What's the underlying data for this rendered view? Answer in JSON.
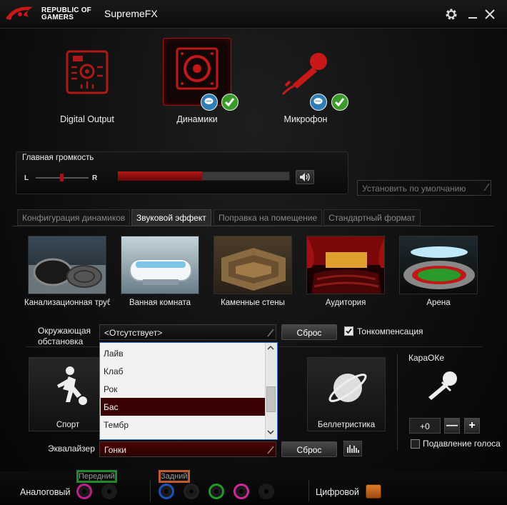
{
  "window": {
    "brand_line1": "REPUBLIC OF",
    "brand_line2": "GAMERS",
    "title": "SupremeFX"
  },
  "devices": [
    {
      "label": "Digital Output",
      "icon": "digital-output-icon",
      "selected": false
    },
    {
      "label": "Динамики",
      "icon": "speaker-icon",
      "selected": true
    },
    {
      "label": "Микрофон",
      "icon": "microphone-icon",
      "selected": false
    }
  ],
  "volume": {
    "title": "Главная громкость",
    "left": "L",
    "right": "R",
    "level": 0.49,
    "balance": 0.5
  },
  "default_button": "Установить по умолчанию",
  "tabs": [
    {
      "label": "Конфигурация динамиков",
      "active": false
    },
    {
      "label": "Звуковой эффект",
      "active": true
    },
    {
      "label": "Поправка на помещение",
      "active": false
    },
    {
      "label": "Стандартный формат",
      "active": false
    }
  ],
  "environments": [
    {
      "label": "Канализационная труба"
    },
    {
      "label": "Ванная комната"
    },
    {
      "label": "Каменные стены"
    },
    {
      "label": "Аудитория"
    },
    {
      "label": "Арена"
    }
  ],
  "environment": {
    "caption_line1": "Окружающая",
    "caption_line2": "обстановка",
    "value": "<Отсутствует>",
    "reset": "Сброс",
    "loudness": "Тонкомпенсация",
    "loudness_checked": true
  },
  "equalizer": {
    "caption": "Эквалайзер",
    "value": "Гонки",
    "reset": "Сброс",
    "presets": [
      {
        "label": "Спорт"
      },
      {
        "label": "Беллетристика"
      }
    ],
    "dropdown": [
      "Лайв",
      "Клаб",
      "Рок",
      "Бас",
      "Тембр"
    ],
    "dropdown_selected": "Бас"
  },
  "karaoke": {
    "title": "КараОКе",
    "value": "+0",
    "minus": "—",
    "plus": "+",
    "voice_cancel": "Подавление голоса"
  },
  "jacks": {
    "front_label": "Передний",
    "rear_label": "Задний",
    "analog_label": "Аналоговый",
    "digital_label": "Цифровой",
    "front_colors": [
      "#1f8a2a",
      "#c0208a"
    ],
    "rear_colors": [
      "#c05a2a",
      "#1e4fc0",
      "#222222",
      "#1f9a2a",
      "#d02a9a"
    ]
  }
}
